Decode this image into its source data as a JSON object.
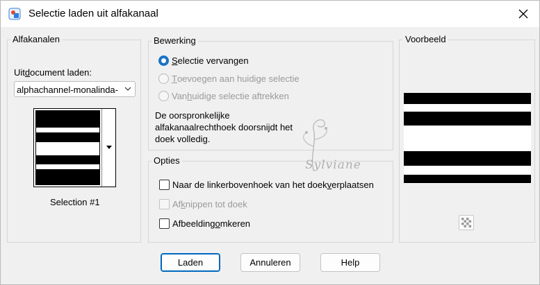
{
  "window": {
    "title": "Selectie laden uit alfakanaal"
  },
  "alpha": {
    "group_label": "Alfakanalen",
    "load_label_pre": "Uit ",
    "load_label_key": "d",
    "load_label_post": "ocument laden:",
    "selected_document": "alphachannel-monalinda-",
    "selection_name": "Selection #1"
  },
  "operation": {
    "group_label": "Bewerking",
    "opt1": {
      "key": "S",
      "rest": "electie vervangen",
      "checked": true
    },
    "opt2": {
      "key": "T",
      "rest": "oevoegen aan huidige selectie",
      "enabled": false
    },
    "opt3_pre": "Van ",
    "opt3_key": "h",
    "opt3_post": "uidige selectie aftrekken",
    "note": "De oorspronkelijke alfakanaalrechthoek doorsnijdt het doek volledig."
  },
  "options": {
    "group_label": "Opties",
    "c1_pre": "Naar de linkerbovenhoek van het doek ",
    "c1_key": "v",
    "c1_post": "erplaatsen",
    "c2_pre": "Af",
    "c2_key": "k",
    "c2_post": "nippen tot doek",
    "c3_pre": "Afbeelding ",
    "c3_key": "o",
    "c3_post": "mkeren"
  },
  "preview": {
    "group_label": "Voorbeeld"
  },
  "buttons": {
    "load": "Laden",
    "cancel": "Annuleren",
    "help": "Help"
  },
  "watermark": {
    "text": "Sylviane"
  },
  "colors": {
    "accent": "#1a73c7",
    "default_button_border": "#0067c0"
  }
}
